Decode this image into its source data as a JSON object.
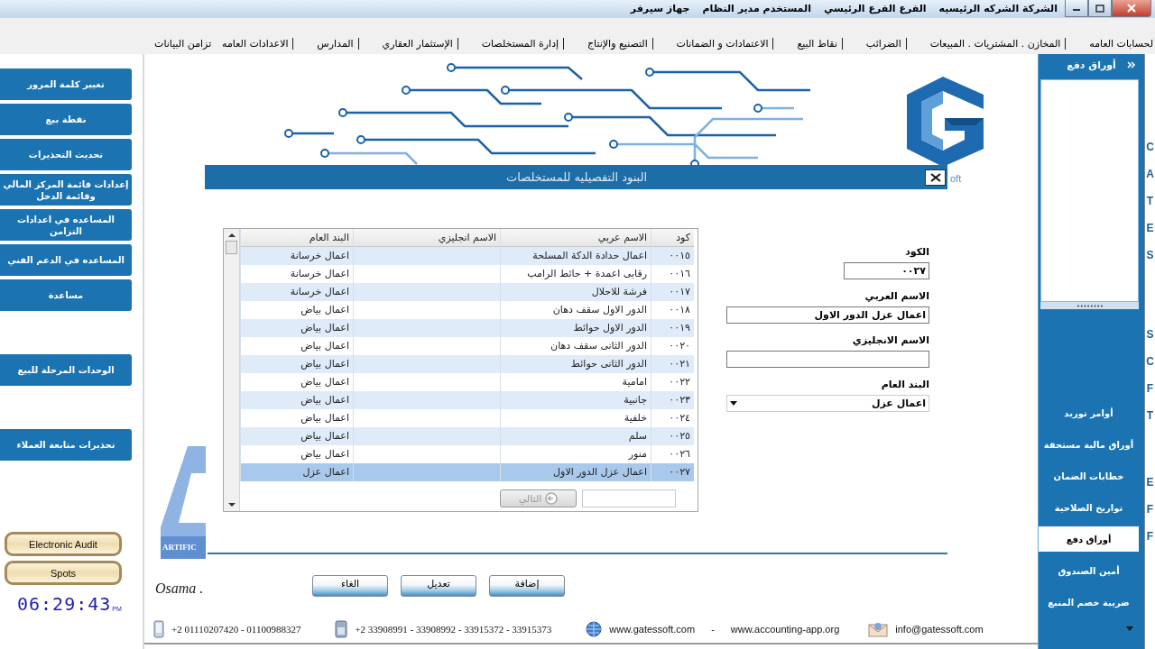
{
  "title_bar": {
    "info": [
      "الشركة الشركه الرئيسيه",
      "الفرع الفرع الرئيسي",
      "المستخدم مدير النظام",
      "جهاز سيرفر"
    ]
  },
  "menu": [
    {
      "label": "لحسابات العامه",
      "divider": true
    },
    {
      "label": "المخازن . المشتريات . المبيعات",
      "divider": true
    },
    {
      "label": "الضرائب",
      "divider": true
    },
    {
      "label": "نقاط البيع",
      "divider": true
    },
    {
      "label": "الاعتمادات و الضمانات",
      "divider": true
    },
    {
      "label": "التصنيع والإنتاج",
      "divider": true
    },
    {
      "label": "إدارة المستخلصات",
      "divider": true
    },
    {
      "label": "الإستثمار العقاري",
      "divider": true
    },
    {
      "label": "المدارس",
      "divider": true
    },
    {
      "label": "الاعدادات العامه",
      "divider": false
    },
    {
      "label": "تزامن البيانات",
      "divider": false
    }
  ],
  "sidebar": {
    "groups": [
      [
        "تغيير كلمة المرور",
        "نقطة بيع",
        "تحديث التحذيرات",
        "إعدادات قائمة المركز المالي وقائمة الدخل",
        "المساعده في اعدادات التزامن",
        "المساعده في الدعم الفني",
        "مساعدة"
      ],
      [
        "الوحدات المرحلة للبيع"
      ],
      [
        "تحذيرات متابعة العملاء"
      ]
    ],
    "extra_buttons": [
      "Electronic Audit",
      "Spots"
    ],
    "clock": {
      "time": "06:29:43",
      "period": "PM"
    }
  },
  "background": {
    "logo_fragment": "oft",
    "logo_caption": "ARTIFIC",
    "signature": "Osama ."
  },
  "dialog": {
    "title": "البنود التفصيليه للمستخلصات",
    "grid": {
      "columns": [
        "كود",
        "الاسم عربي",
        "الاسم انجليزي",
        "البند العام"
      ],
      "rows": [
        {
          "code": "٠٠١٥",
          "arabic_name": "اعمال حدادة الدكة المسلحة",
          "general_item": "اعمال خرسانة",
          "selected": false
        },
        {
          "code": "٠٠١٦",
          "arabic_name": "رقابى اعمدة + حائط الرامب",
          "general_item": "اعمال خرسانة",
          "selected": false
        },
        {
          "code": "٠٠١٧",
          "arabic_name": "فرشة للاحلال",
          "general_item": "اعمال خرسانة",
          "selected": false
        },
        {
          "code": "٠٠١٨",
          "arabic_name": "الدور الاول سقف دهان",
          "general_item": "اعمال بياض",
          "selected": false
        },
        {
          "code": "٠٠١٩",
          "arabic_name": "الدور الاول حوائط",
          "general_item": "اعمال بياض",
          "selected": false
        },
        {
          "code": "٠٠٢٠",
          "arabic_name": "الدور الثانى سقف دهان",
          "general_item": "اعمال بياض",
          "selected": false
        },
        {
          "code": "٠٠٢١",
          "arabic_name": "الدور الثانى حوائط",
          "general_item": "اعمال بياض",
          "selected": false
        },
        {
          "code": "٠٠٢٢",
          "arabic_name": "امامية",
          "general_item": "اعمال بياض",
          "selected": false
        },
        {
          "code": "٠٠٢٣",
          "arabic_name": "جانبية",
          "general_item": "اعمال بياض",
          "selected": false
        },
        {
          "code": "٠٠٢٤",
          "arabic_name": "خلفية",
          "general_item": "اعمال بياض",
          "selected": false
        },
        {
          "code": "٠٠٢٥",
          "arabic_name": "سلم",
          "general_item": "اعمال بياض",
          "selected": false
        },
        {
          "code": "٠٠٢٦",
          "arabic_name": "منور",
          "general_item": "اعمال بياض",
          "selected": false
        },
        {
          "code": "٠٠٢٧",
          "arabic_name": "اعمال عزل الدور الاول",
          "general_item": "اعمال عزل",
          "selected": true
        }
      ],
      "next_button": {
        "label": "التالي",
        "disabled": true
      }
    },
    "form": {
      "fields": [
        {
          "label": "الكود",
          "value": "٠٠٢٧",
          "kind": "text"
        },
        {
          "label": "الاسم العربي",
          "value": "اعمال عزل الدور الاول",
          "kind": "text"
        },
        {
          "label": "الاسم الانجليزي",
          "kind": "text"
        },
        {
          "label": "البند العام",
          "value": "اعمال عزل",
          "kind": "select"
        }
      ]
    }
  },
  "actions": [
    "إضافة",
    "تعديل",
    "الغاء"
  ],
  "footer": [
    {
      "kind": "email",
      "text": "info@gatessoft.com"
    },
    {
      "kind": "plain",
      "text": "www.accounting-app.org"
    },
    {
      "kind": "plain",
      "text": "-"
    },
    {
      "kind": "web",
      "text": "www.gatessoft.com"
    },
    {
      "kind": "phone",
      "text": "+2 33908991 - 33908992 -  33915372 - 33915373"
    },
    {
      "kind": "mobile",
      "text": "+2 01110207420  - 01100988327"
    }
  ],
  "right_panel": {
    "header": "أوراق دفع",
    "items": [
      {
        "label": "أوامر توريد",
        "selected": false
      },
      {
        "label": "أوراق مالية مستحقة",
        "selected": false
      },
      {
        "label": "خطابات الضمان",
        "selected": false
      },
      {
        "label": "تواريخ الصلاحية",
        "selected": false
      },
      {
        "label": "أوراق دفع",
        "selected": true
      },
      {
        "label": "أمين الصندوق",
        "selected": false
      },
      {
        "label": "ضريبة خصم المنبع",
        "selected": false
      }
    ]
  },
  "edge_letters": [
    [
      "C",
      "A",
      "T",
      "E",
      "S"
    ],
    [
      "S",
      "C",
      "F",
      "T"
    ],
    [
      "E",
      "F",
      "F"
    ]
  ]
}
